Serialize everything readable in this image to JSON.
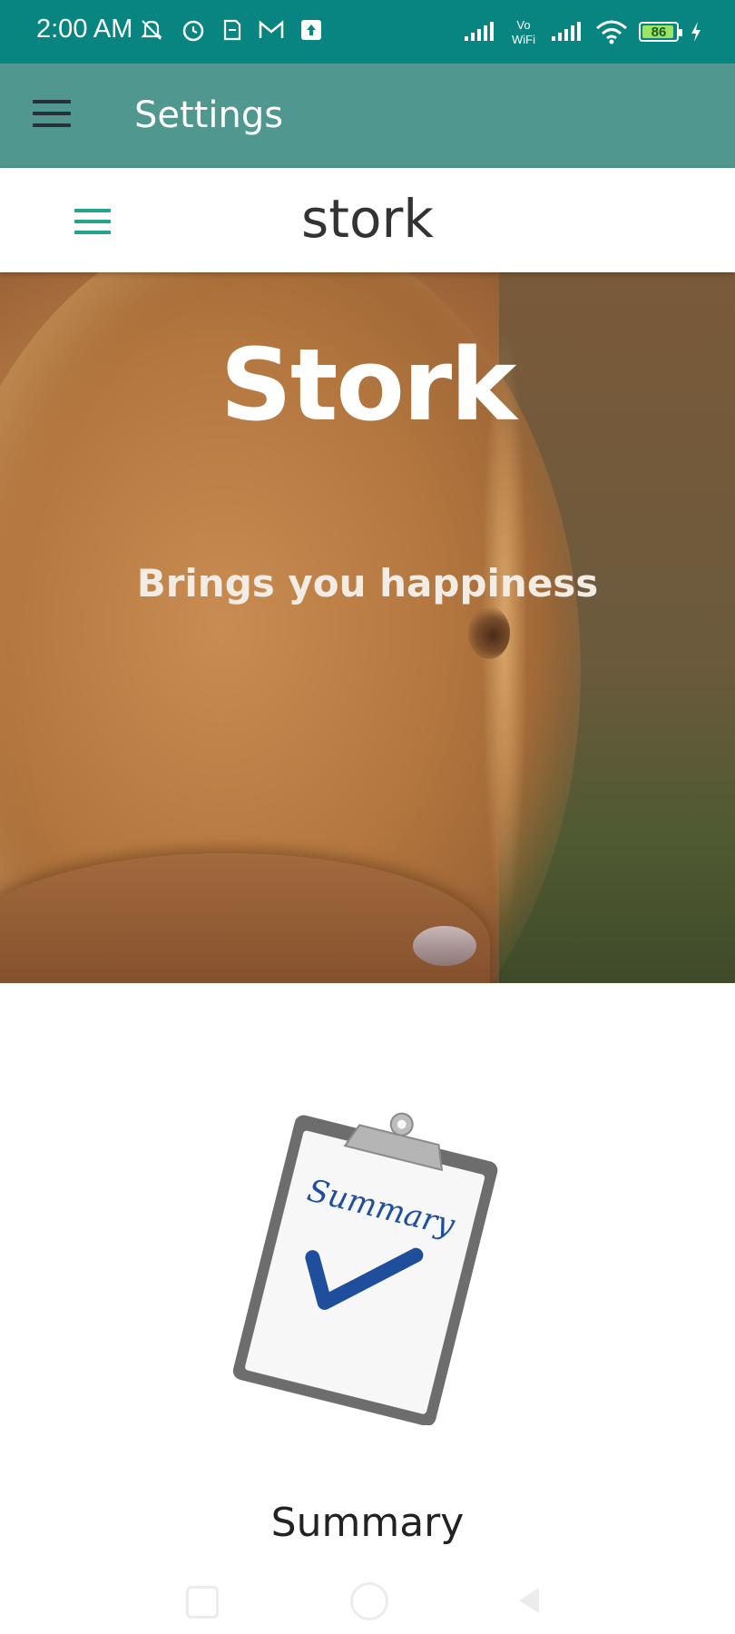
{
  "status_bar": {
    "time": "2:00 AM",
    "left_icons": [
      "mute-notification-icon",
      "alarm-icon",
      "sim-icon",
      "gmail-icon",
      "upload-icon"
    ],
    "right_icons": [
      "signal-icon",
      "vowifi-icon",
      "signal-icon",
      "wifi-icon",
      "battery-icon",
      "charging-icon"
    ],
    "vowifi_label": "Vo WiFi",
    "battery_level": "86",
    "color": "#088580"
  },
  "toolbar": {
    "title": "Settings",
    "color": "#4f978f"
  },
  "web_header": {
    "brand": "stork",
    "menu_icon": "hamburger-icon",
    "accent_color": "#21a38f"
  },
  "hero": {
    "title": "Stork",
    "subtitle": "Brings you happiness"
  },
  "summary": {
    "image_text": "Summary",
    "label": "Summary"
  },
  "nav_bar": {
    "buttons": [
      "recent-apps",
      "home",
      "back"
    ]
  }
}
